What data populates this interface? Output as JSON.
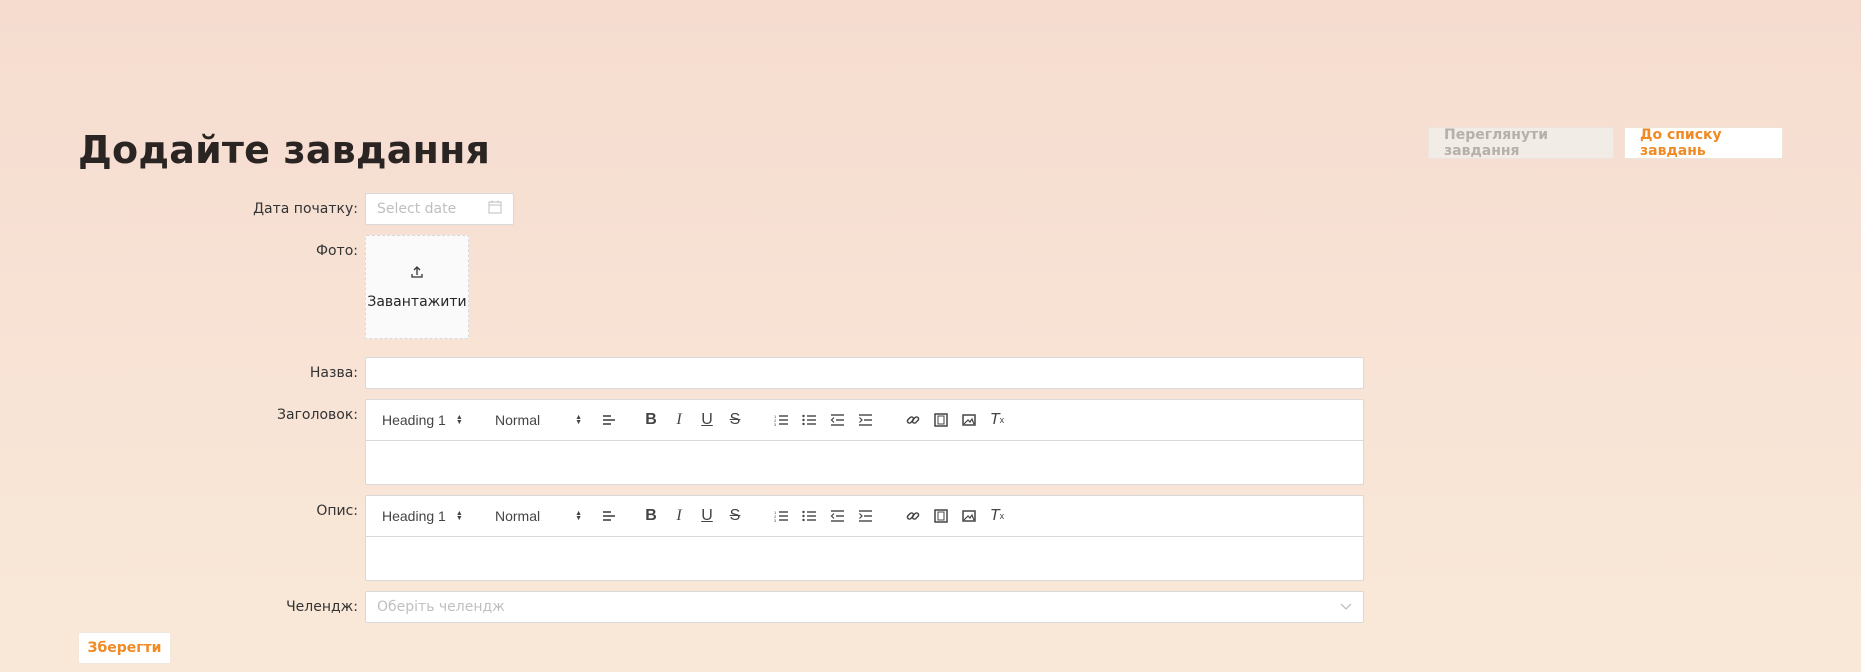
{
  "page": {
    "title": "Додайте завдання"
  },
  "header_buttons": {
    "view_tasks": "Переглянути завдання",
    "to_list": "До списку завдань"
  },
  "form": {
    "start_date": {
      "label": "Дата початку:",
      "placeholder": "Select date",
      "icon": "calendar-icon"
    },
    "photo": {
      "label": "Фото:",
      "upload_text": "Завантажити",
      "icon": "upload-icon"
    },
    "name": {
      "label": "Назва:",
      "value": ""
    },
    "heading": {
      "label": "Заголовок:"
    },
    "description": {
      "label": "Опис:"
    },
    "challenge": {
      "label": "Челендж:",
      "placeholder": "Оберіть челендж",
      "icon": "chevron-down-icon"
    }
  },
  "editor_toolbar": {
    "header_select": "Heading 1",
    "size_select": "Normal"
  },
  "actions": {
    "save": "Зберегти"
  },
  "colors": {
    "accent": "#f08a24",
    "bg_top": "#f5dccf",
    "bg_bottom": "#f9e8d8"
  }
}
